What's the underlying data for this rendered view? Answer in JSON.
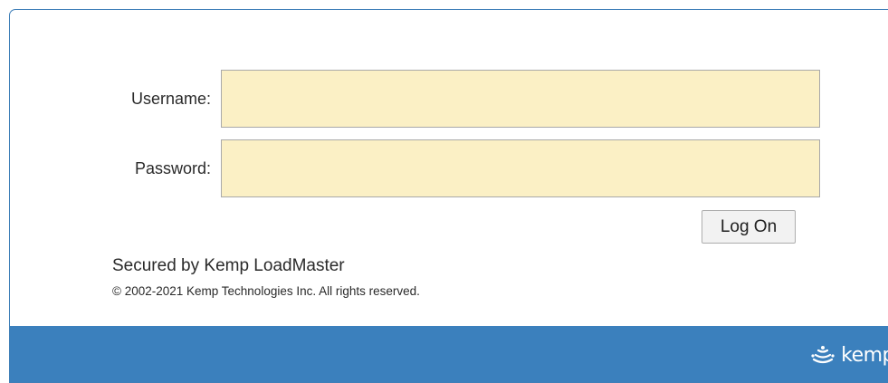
{
  "form": {
    "username_label": "Username:",
    "username_value": "",
    "password_label": "Password:",
    "password_value": "",
    "logon_label": "Log On"
  },
  "footer": {
    "secured_text": "Secured by Kemp LoadMaster",
    "copyright_text": "© 2002-2021 Kemp Technologies Inc. All rights reserved.",
    "brand_text": "kemp",
    "brand_icon": "kemp-logo-icon"
  },
  "colors": {
    "accent": "#3b80bd",
    "input_bg": "#fbf0c5"
  }
}
